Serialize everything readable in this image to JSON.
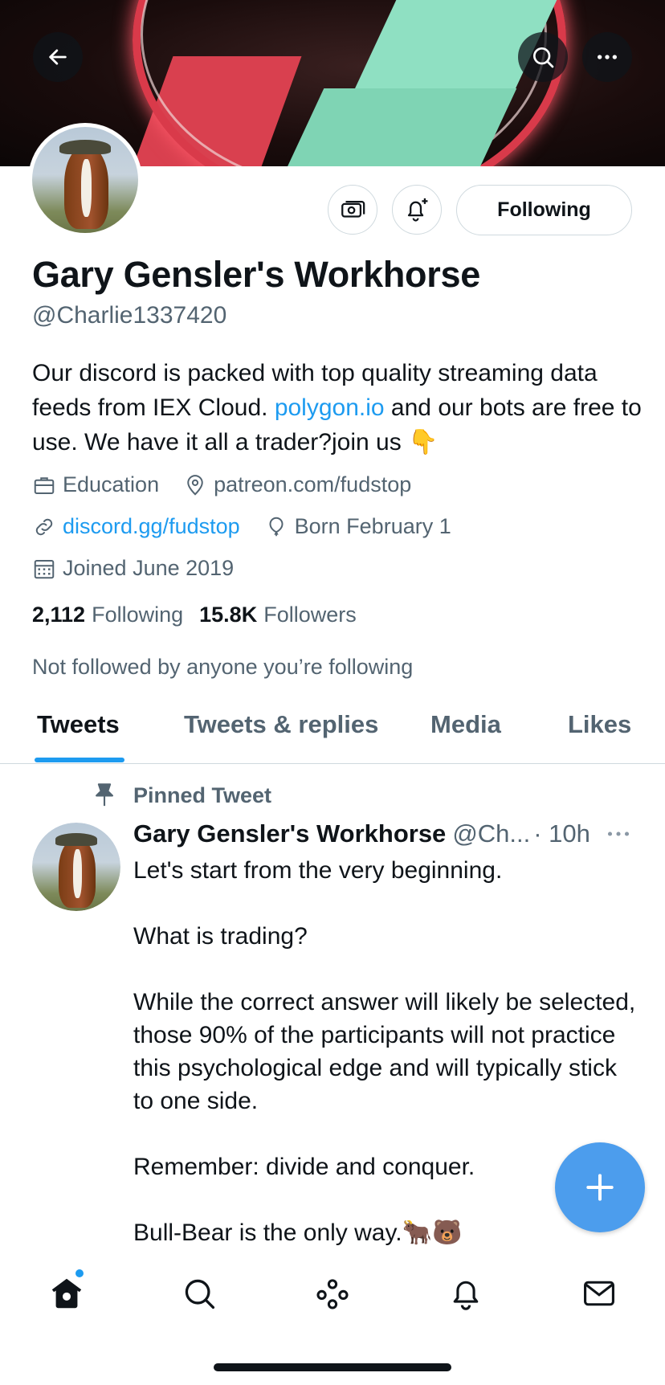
{
  "profile": {
    "name": "Gary Gensler's Workhorse",
    "handle": "@Charlie1337420",
    "bio_part1": "Our discord is packed with top quality streaming data feeds from IEX Cloud. ",
    "bio_link": "polygon.io",
    "bio_part2": " and our bots are free to use. We have it all a trader?join us 👇",
    "category": "Education",
    "location": "patreon.com/fudstop",
    "website": "discord.gg/fudstop",
    "birthday": "Born February 1",
    "joined": "Joined June 2019",
    "following_count": "2,112",
    "following_label": "Following",
    "followers_count": "15.8K",
    "followers_label": "Followers",
    "not_followed": "Not followed by anyone you’re following"
  },
  "actions": {
    "following_button": "Following"
  },
  "tabs": [
    {
      "label": "Tweets",
      "active": true
    },
    {
      "label": "Tweets & replies",
      "active": false
    },
    {
      "label": "Media",
      "active": false
    },
    {
      "label": "Likes",
      "active": false
    }
  ],
  "tweet": {
    "pinned_label": "Pinned Tweet",
    "author": "Gary Gensler's Workhorse",
    "handle": "@Ch...",
    "time": "· 10h",
    "paragraphs": [
      "Let's start from the very beginning.",
      "What is trading?",
      "While the correct answer will likely be selected, those 90% of the participants will not practice this psychological edge and will typically stick to one side.",
      "Remember: divide and conquer.",
      "Bull-Bear is the only way.🐂🐻"
    ]
  },
  "icons": {
    "back": "arrow-left-icon",
    "search": "search-icon",
    "more": "more-icon",
    "tips": "money-icon",
    "notify": "bell-plus-icon",
    "compose": "plus-icon"
  },
  "nav": [
    "home-icon",
    "search-icon",
    "spaces-icon",
    "notifications-icon",
    "messages-icon"
  ],
  "colors": {
    "accent": "#1d9bf0",
    "secondary_text": "#536471",
    "fab": "#4c9ded"
  }
}
